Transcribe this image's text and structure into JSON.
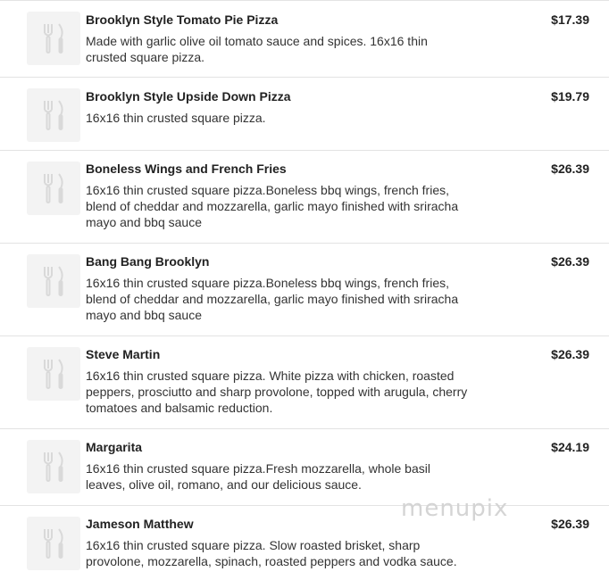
{
  "menu": {
    "items": [
      {
        "name": "Brooklyn Style Tomato Pie Pizza",
        "description": "Made with garlic olive oil tomato sauce and spices. 16x16 thin crusted square pizza.",
        "price": "$17.39",
        "icon": "utensils-icon"
      },
      {
        "name": "Brooklyn Style Upside Down Pizza",
        "description": "16x16 thin crusted square pizza.",
        "price": "$19.79",
        "icon": "utensils-icon"
      },
      {
        "name": "Boneless Wings and French Fries",
        "description": "16x16 thin crusted square pizza.Boneless bbq wings, french fries, blend of cheddar and mozzarella, garlic mayo finished with sriracha mayo and bbq sauce",
        "price": "$26.39",
        "icon": "utensils-icon"
      },
      {
        "name": "Bang Bang Brooklyn",
        "description": "16x16 thin crusted square pizza.Boneless bbq wings, french fries, blend of cheddar and mozzarella, garlic mayo finished with sriracha mayo and bbq sauce",
        "price": "$26.39",
        "icon": "utensils-icon"
      },
      {
        "name": "Steve Martin",
        "description": "16x16 thin crusted square pizza. White pizza with chicken, roasted peppers, prosciutto and sharp provolone, topped with arugula, cherry tomatoes and balsamic reduction.",
        "price": "$26.39",
        "icon": "utensils-icon"
      },
      {
        "name": "Margarita",
        "description": "16x16 thin crusted square pizza.Fresh mozzarella, whole basil leaves, olive oil, romano, and our delicious sauce.",
        "price": "$24.19",
        "icon": "utensils-icon"
      },
      {
        "name": "Jameson Matthew",
        "description": "16x16 thin crusted square pizza. Slow roasted brisket, sharp provolone, mozzarella, spinach, roasted peppers and vodka sauce.",
        "price": "$26.39",
        "icon": "utensils-icon"
      }
    ]
  },
  "watermark": "menupix"
}
